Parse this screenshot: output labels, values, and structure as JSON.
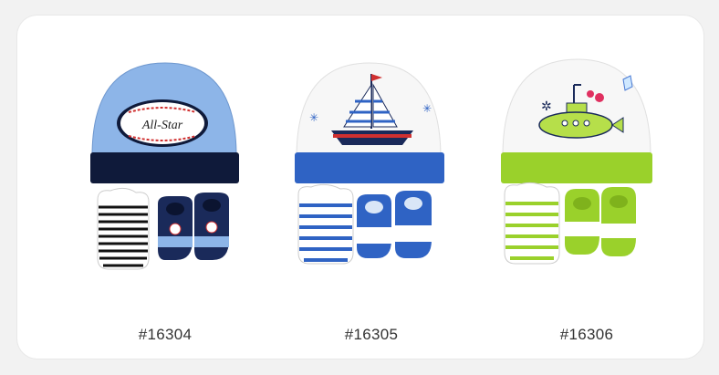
{
  "products": [
    {
      "sku": "#16304",
      "colors": {
        "hat": "#8db5e8",
        "band": "#0f1a3a",
        "accent": "#1b2a5c",
        "mitten_stripe": "#111111",
        "bootie": "#1a2a5a",
        "bootie_trim": "#8db5e8"
      },
      "hat_text": "All-Star",
      "icons": [
        "baseball-hat-icon",
        "striped-mitten-icon",
        "bootie-pair-icon"
      ]
    },
    {
      "sku": "#16305",
      "colors": {
        "hat": "#f7f7f7",
        "band": "#2f63c4",
        "accent": "#2f63c4",
        "mitten_stripe": "#2f63c4",
        "bootie": "#2f63c4",
        "bootie_trim": "#ffffff"
      },
      "icons": [
        "sailboat-hat-icon",
        "striped-mitten-icon",
        "bootie-pair-icon"
      ]
    },
    {
      "sku": "#16306",
      "colors": {
        "hat": "#f7f7f7",
        "band": "#9ad12b",
        "accent": "#9ad12b",
        "mitten_stripe": "#9ad12b",
        "bootie": "#9ad12b",
        "bootie_trim": "#ffffff"
      },
      "icons": [
        "submarine-hat-icon",
        "striped-mitten-icon",
        "bootie-pair-icon"
      ]
    }
  ]
}
